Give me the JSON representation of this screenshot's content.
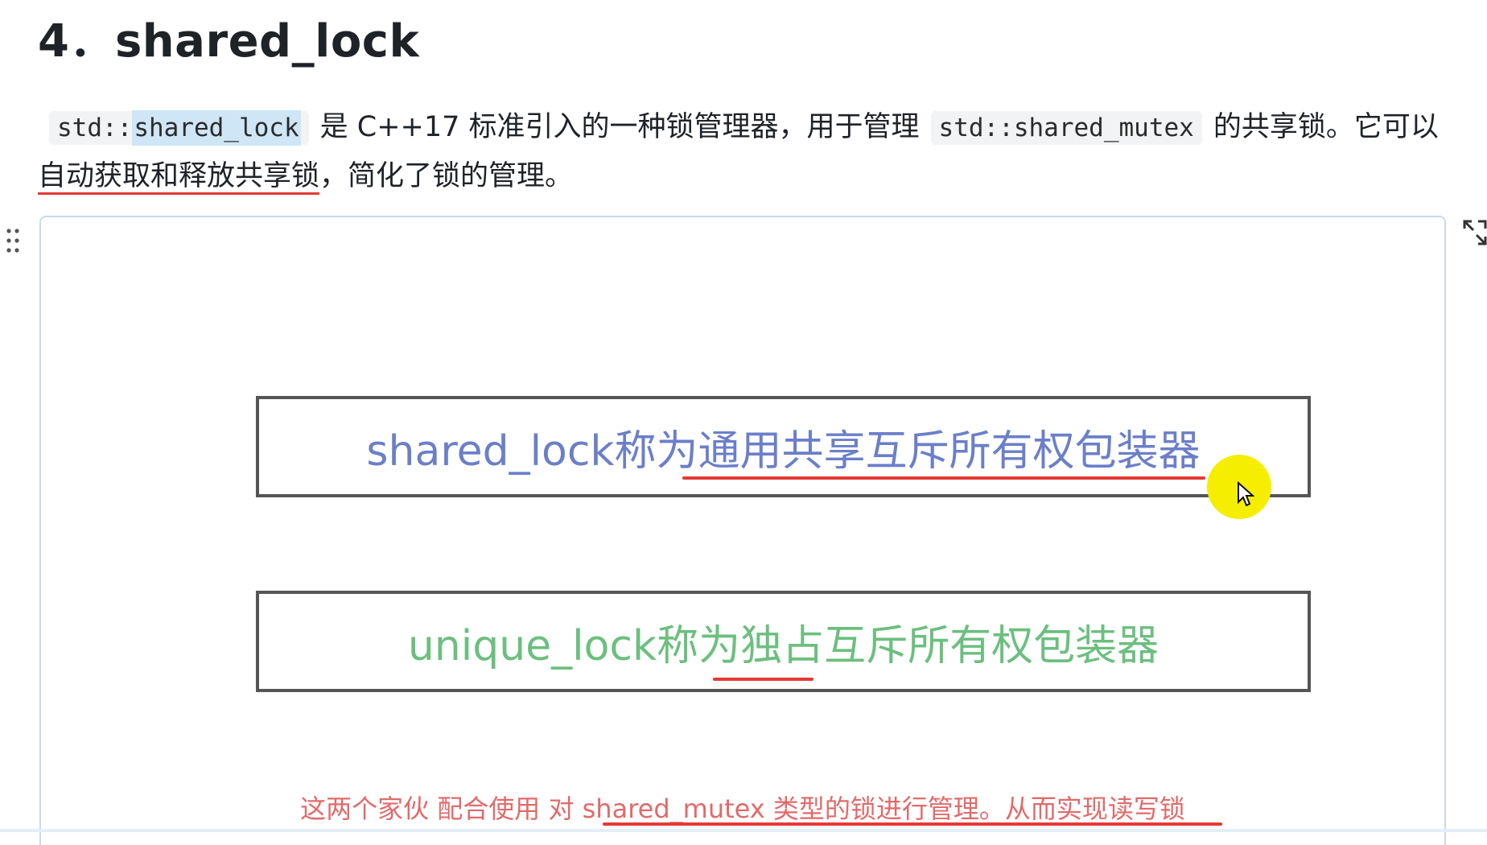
{
  "heading": "4．shared_lock",
  "paragraph": {
    "code1_pre": "std::",
    "code1_hl": "shared_lock",
    "text1": "是 C++17 标准引入的一种锁管理器，用于管理",
    "code2": "std::shared_mutex",
    "text2": "的共享锁。它可以",
    "text3_underlined": "自动获取和释放共享锁",
    "text4": "，简化了锁的管理。"
  },
  "diagram": {
    "box1_prefix": "shared_lock称为",
    "box1_rest": "通用共享互斥所有权包装器",
    "box2_prefix": "unique_lock称为",
    "box2_rest": "独占互斥所有权包装器",
    "note_prefix": "这两个家伙 配合使用 ",
    "note_rest": "对 shared_mutex 类型的锁进行管理。从而实现读写锁"
  },
  "colors": {
    "box1_text": "#6b7fc9",
    "box2_text": "#6cbf7f",
    "note_text": "#e26a6a",
    "underline": "#e53935",
    "cursor_highlight": "#f5ee00"
  },
  "icons": {
    "drag": "drag-handle-icon",
    "expand": "expand-icon",
    "cursor": "mouse-cursor-icon"
  }
}
